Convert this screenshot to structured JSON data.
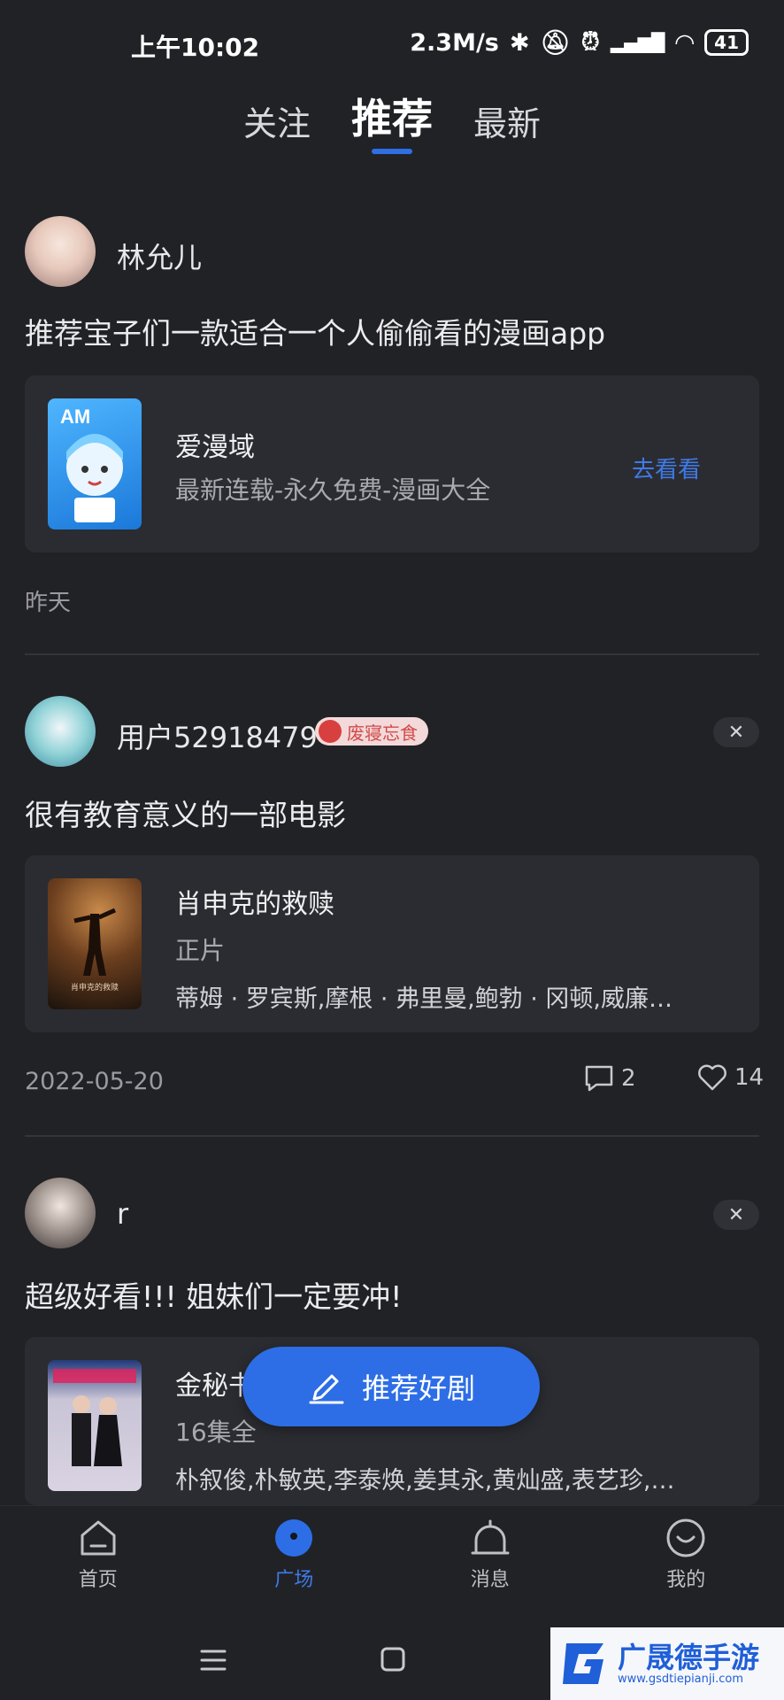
{
  "status_bar": {
    "time": "上午10:02",
    "speed": "2.3M/s",
    "battery": "41"
  },
  "tabs": [
    {
      "label": "关注",
      "active": false
    },
    {
      "label": "推荐",
      "active": true
    },
    {
      "label": "最新",
      "active": false
    }
  ],
  "posts": [
    {
      "user": "林允儿",
      "text": "推荐宝子们一款适合一个人偷偷看的漫画app",
      "card": {
        "title": "爱漫域",
        "subtitle": "最新连载-永久免费-漫画大全",
        "action": "去看看",
        "thumb_text": "AM"
      },
      "time": "昨天"
    },
    {
      "user": "用户52918479",
      "badge": "废寝忘食",
      "text": "很有教育意义的一部电影",
      "card": {
        "title": "肖申克的救赎",
        "subtitle": "正片",
        "cast": "蒂姆 · 罗宾斯,摩根 · 弗里曼,鲍勃 · 冈顿,威廉…",
        "thumb_text": "肖申克的救赎"
      },
      "time": "2022-05-20",
      "comments": "2",
      "likes": "14"
    },
    {
      "user": "r",
      "text": "超级好看!!! 姐妹们一定要冲!",
      "card": {
        "title": "金秘书",
        "subtitle": "16集全",
        "cast": "朴叙俊,朴敏英,李泰焕,姜其永,黄灿盛,表艺珍,…"
      }
    }
  ],
  "fab": {
    "label": "推荐好剧"
  },
  "bottom_nav": [
    {
      "label": "首页",
      "icon": "home-icon"
    },
    {
      "label": "广场",
      "icon": "plaza-icon",
      "active": true
    },
    {
      "label": "消息",
      "icon": "bell-icon"
    },
    {
      "label": "我的",
      "icon": "profile-icon"
    }
  ],
  "watermark": {
    "text": "广晟德手游",
    "url": "www.gsdtiepianji.com"
  },
  "colors": {
    "accent": "#2d6ee6",
    "background": "#212226",
    "card": "#2b2c31"
  }
}
